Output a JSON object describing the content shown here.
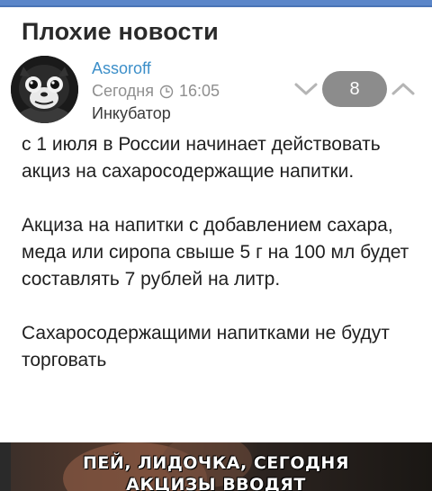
{
  "post": {
    "title": "Плохие новости",
    "author": "Assoroff",
    "date": "Сегодня",
    "time": "16:05",
    "community": "Инкубатор",
    "rating": "8",
    "paragraphs": [
      "с 1 июля в России начинает действовать акциз на сахаросодержащие напитки.",
      "Акциза на напитки с добавлением сахара, меда или сиропа свыше 5 г на 100 мл будет составлять 7 рублей на литр.",
      "Сахаросодержащими напитками не будут торговать"
    ]
  },
  "image": {
    "caption_line1": "ПЕЙ, ЛИДОЧКА, СЕГОДНЯ",
    "caption_line2": "АКЦИЗЫ ВВОДЯТ"
  },
  "icons": {
    "vote_down": "chevron-down-icon",
    "vote_up": "chevron-up-icon",
    "clock": "clock-icon"
  },
  "colors": {
    "accent": "#5b86c9",
    "author_link": "#3c8fc9",
    "rating_badge": "#8c8c8c"
  }
}
